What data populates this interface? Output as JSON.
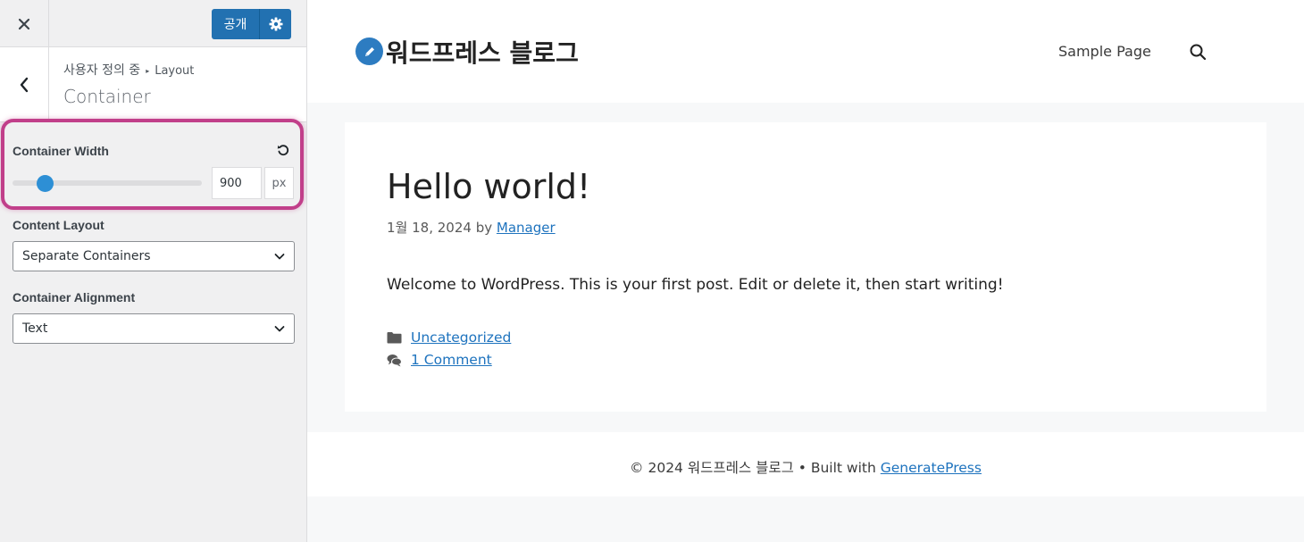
{
  "customizer": {
    "publish_label": "공개",
    "breadcrumb": {
      "parent": "사용자 정의 중",
      "section": "Layout"
    },
    "section_title": "Container",
    "controls": {
      "container_width": {
        "label": "Container Width",
        "value": "900",
        "unit": "px",
        "slider_fraction": 0.17
      },
      "content_layout": {
        "label": "Content Layout",
        "selected": "Separate Containers"
      },
      "container_alignment": {
        "label": "Container Alignment",
        "selected": "Text"
      }
    },
    "colors": {
      "accent": "#2271b1",
      "highlight": "#c13f8a"
    }
  },
  "site": {
    "title": "워드프레스 블로그",
    "nav": {
      "sample_page": "Sample Page"
    },
    "post": {
      "title": "Hello world!",
      "date": "1월 18, 2024",
      "by": "by",
      "author": "Manager",
      "body": "Welcome to WordPress. This is your first post. Edit or delete it, then start writing!",
      "category": "Uncategorized",
      "comments": "1 Comment"
    },
    "footer": {
      "copyright": "© 2024 워드프레스 블로그 • Built with",
      "link": "GeneratePress"
    }
  },
  "icons": [
    "close-icon",
    "gear-icon",
    "chevron-left-icon",
    "reset-icon",
    "chevron-down-icon",
    "pencil-icon",
    "search-icon",
    "folder-icon",
    "comments-icon"
  ]
}
